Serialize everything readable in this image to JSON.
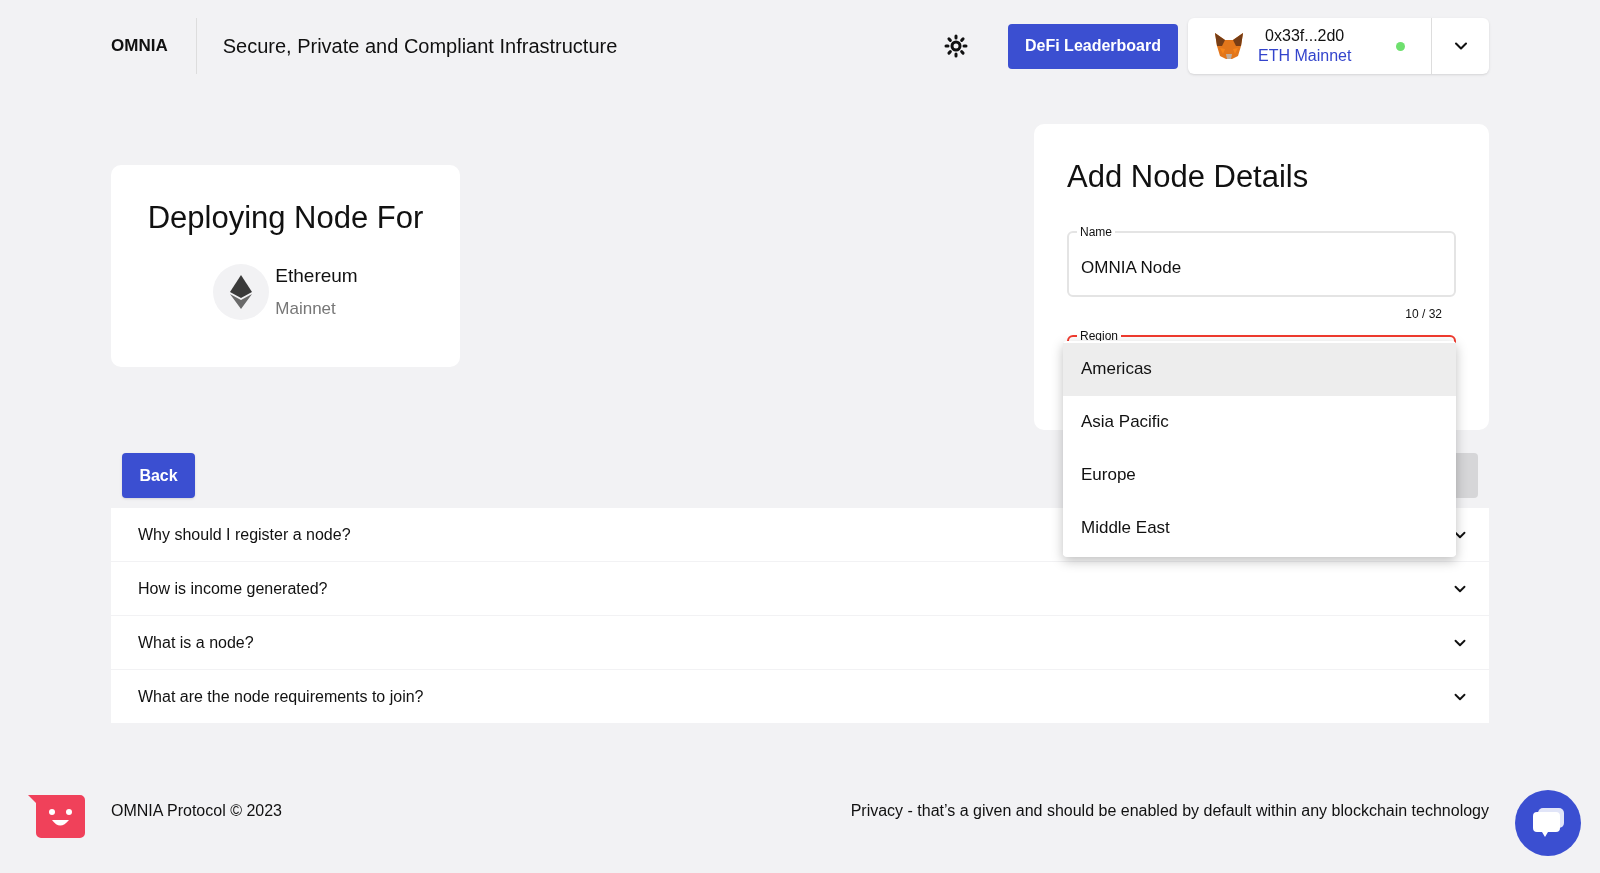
{
  "header": {
    "logo": "OMNIA",
    "tagline": "Secure, Private and Compliant Infrastructure",
    "leaderboard_button": "DeFi Leaderboard",
    "wallet": {
      "address": "0x33f...2d0",
      "network": "ETH Mainnet",
      "connected": true
    }
  },
  "deploy_card": {
    "title": "Deploying Node For",
    "chain": {
      "name": "Ethereum",
      "network": "Mainnet"
    }
  },
  "node_form": {
    "title": "Add Node Details",
    "name_field": {
      "label": "Name",
      "value": "OMNIA Node",
      "counter": "10 / 32"
    },
    "region_field": {
      "label": "Region",
      "error": true,
      "open": true,
      "options": [
        {
          "label": "Americas",
          "selected": true
        },
        {
          "label": "Asia Pacific",
          "selected": false
        },
        {
          "label": "Europe",
          "selected": false
        },
        {
          "label": "Middle East",
          "selected": false
        }
      ]
    }
  },
  "actions": {
    "back": "Back",
    "next_disabled": true
  },
  "faq": [
    {
      "question": "Why should I register a node?",
      "expanded": false
    },
    {
      "question": "How is income generated?",
      "expanded": false
    },
    {
      "question": "What is a node?",
      "expanded": false
    },
    {
      "question": "What are the node requirements to join?",
      "expanded": false
    }
  ],
  "footer": {
    "copyright": "OMNIA Protocol © 2023",
    "note": "Privacy - that’s a given and should be enabled by default within any blockchain technology"
  }
}
